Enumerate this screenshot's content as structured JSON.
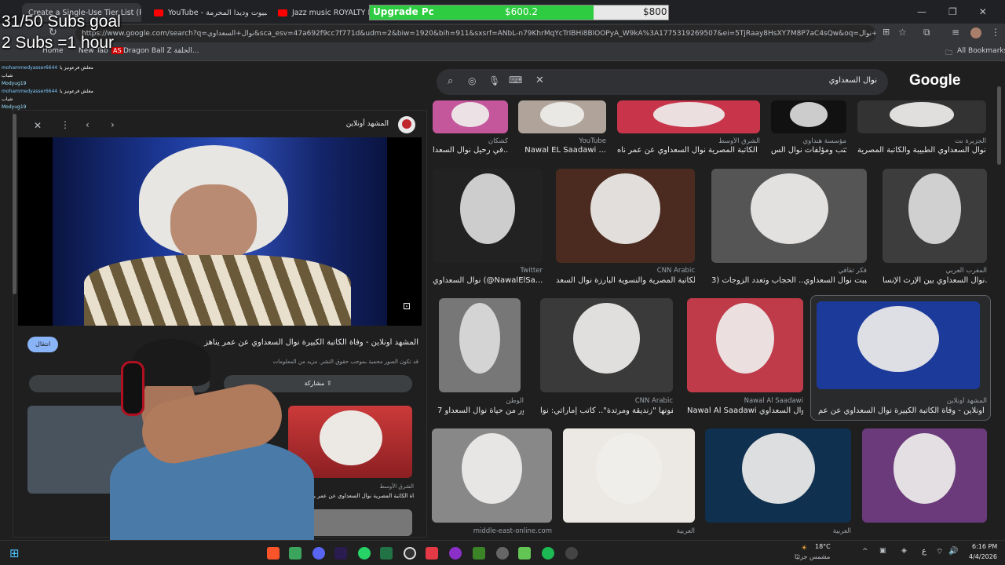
{
  "tabs": [
    {
      "label": "Create a Single-Use Tier List (P..."
    },
    {
      "label": "YouTube - إيستبيوت وديدا المحرمة"
    },
    {
      "label": "Jazz music ROYALTY FREE Bac..."
    }
  ],
  "address": {
    "url": "https://www.google.com/search?q=نوال+السعداوي&sca_esv=47a692f9cc7f771d&udm=2&biw=1920&bih=911&sxsrf=ANbL-n79KhrMqYcTrIBHi8BlOOPyA_W9kA%3A1775319269507&ei=5TjRaay8HsXY7M8P7aC4sQw&oq=ال+نوال&gs_lp=Egtnd..."
  },
  "bookmarks": {
    "home": "Home",
    "newtab": "New Tab",
    "dbz": "Dragon Ball Z الحلقة...",
    "all": "All Bookmarks"
  },
  "stream_overlay": {
    "subs_goal": "31/50 Subs goal",
    "subs_hour": "2 Subs =1 hour",
    "upgrade_label": "Upgrade Pc",
    "upgrade_current": "$600.2",
    "upgrade_target": "$800",
    "upgrade_progress": 0.75
  },
  "chat": [
    {
      "user": "mohammedyasser6644",
      "msg": "معلش فرعونيز يا شباب"
    },
    {
      "user": "Modyug19",
      "msg": ""
    },
    {
      "user": "mohammedyasser6644",
      "msg": "معلش فرعونيز يا شباب"
    },
    {
      "user": "Modyug19",
      "msg": ""
    }
  ],
  "search": {
    "query": "نوال السعداوي",
    "logo": "Google"
  },
  "preview": {
    "source": "المشهد أونلاين",
    "title": "المشهد أونلاين - وفاة الكاتبة الكبيرة نوال السعداوي عن عمر يناهز",
    "notice": "قد تكون الصور محمية بموجب حقوق النشر. مزيد من المعلومات",
    "visit": "انتقال",
    "share": "مشاركة",
    "related_source": "الشرق الأوسط",
    "related_title": "وفاة الكاتبة المصرية نوال السعداوي عن عمر يناهز 90"
  },
  "results": [
    {
      "src": "كشكان",
      "title": "في رحيل نوال السعدا..."
    },
    {
      "src": "YouTube",
      "title": "Nawal EL Saadawi ..."
    },
    {
      "src": "الشرق الأوسط",
      "title": "وفاة الكاتبة المصرية نوال السعداوي عن عمر ناه..."
    },
    {
      "src": "مؤسسة هنداوي",
      "title": "كتب ومؤلفات نوال الس..."
    },
    {
      "src": "الجزيرة نت",
      "title": "نوال السعداوي الطبيبة والكاتبة المصرية | ..."
    },
    {
      "src": "Twitter",
      "title": "نوال السعداوي (@NawalElSa..."
    },
    {
      "src": "CNN Arabic",
      "title": "وفاة الكاتبة المصرية والنسوية البارزة نوال السعد..."
    },
    {
      "src": "فكر ثقافي",
      "title": "ماذا أحببت نوال السعداوي.. الحجاب وتعدد الزوجات (3..."
    },
    {
      "src": "المغرب العربي",
      "title": "نوال السعداوي بين الإرث الإنسا..."
    },
    {
      "src": "الوطن",
      "title": "7 صور من حياة نوال السعداو..."
    },
    {
      "src": "CNN Arabic",
      "title": "يصفونها \"زنديقة ومرتدة\".. كاتب إماراتي: نوا..."
    },
    {
      "src": "Nawal Al Saadawi",
      "title": "Nawal Al Saadawi نوال السعداوي"
    },
    {
      "src": "المشهد أونلاين",
      "title": "المشهد أونلاين - وفاة الكاتبة الكبيرة نوال السعداوي عن عم..."
    },
    {
      "src": "middle-east-online.com",
      "title": ""
    },
    {
      "src": "العربية",
      "title": ""
    },
    {
      "src": "العربية",
      "title": ""
    }
  ],
  "taskbar": {
    "weather_temp": "18°C",
    "weather_desc": "مشمس جزئيًا",
    "time": "6:16 PM",
    "date": "4/4/2026",
    "lang": "ع"
  },
  "colors": {
    "bg": "#1f1f1f",
    "upgrade_green": "#2ecc40"
  }
}
